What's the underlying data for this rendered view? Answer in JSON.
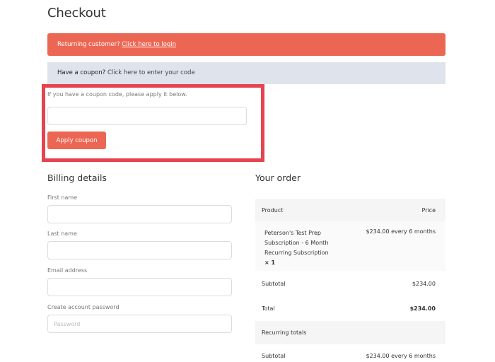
{
  "page": {
    "title": "Checkout"
  },
  "notices": {
    "login": {
      "text": "Returning customer? ",
      "link": "Click here to login"
    },
    "coupon": {
      "text": "Have a coupon? ",
      "link": "Click here to enter your code"
    }
  },
  "coupon_form": {
    "hint": "If you have a coupon code, please apply it below.",
    "input_value": "",
    "input_placeholder": "",
    "apply_label": "Apply coupon"
  },
  "billing": {
    "title": "Billing details",
    "fields": [
      {
        "label": "First name",
        "value": "",
        "placeholder": ""
      },
      {
        "label": "Last name",
        "value": "",
        "placeholder": ""
      },
      {
        "label": "Email address",
        "value": "",
        "placeholder": ""
      },
      {
        "label": "Create account password",
        "value": "",
        "placeholder": "Password"
      }
    ]
  },
  "order": {
    "title": "Your order",
    "columns": {
      "product": "Product",
      "price": "Price"
    },
    "items": [
      {
        "name": "Peterson's Test Prep Subscription - 6 Month Recurring Subscription",
        "quantity": "× 1",
        "price": "$234.00 every 6 months"
      }
    ],
    "subtotal_label": "Subtotal",
    "subtotal_value": "$234.00",
    "total_label": "Total",
    "total_value": "$234.00",
    "recurring_label": "Recurring totals",
    "recurring_subtotal_label": "Subtotal",
    "recurring_subtotal_value": "$234.00 every 6 months"
  },
  "colors": {
    "accent": "#ec6753",
    "notice_bg": "#dfe3eb",
    "highlight_border": "#e5434f"
  }
}
